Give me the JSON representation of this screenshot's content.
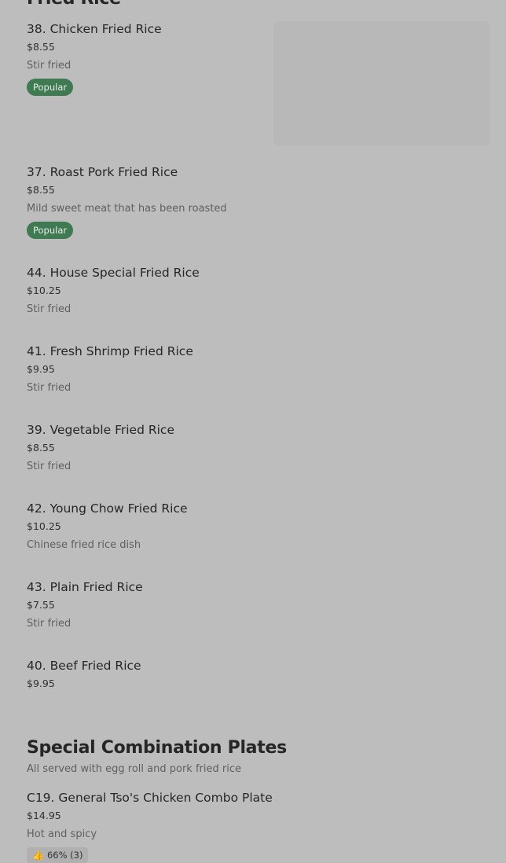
{
  "fried_rice": {
    "title": "Fried Rice",
    "items": [
      {
        "name": "38. Chicken Fried Rice",
        "price": "$8.55",
        "desc": "Stir fried",
        "badge": "Popular"
      },
      {
        "name": "37. Roast Pork Fried Rice",
        "price": "$8.55",
        "desc": "Mild sweet meat that has been roasted",
        "badge": "Popular"
      },
      {
        "name": "44. House Special Fried Rice",
        "price": "$10.25",
        "desc": "Stir fried"
      },
      {
        "name": "41. Fresh Shrimp Fried Rice",
        "price": "$9.95",
        "desc": "Stir fried"
      },
      {
        "name": "39. Vegetable Fried Rice",
        "price": "$8.55",
        "desc": "Stir fried"
      },
      {
        "name": "42. Young Chow Fried Rice",
        "price": "$10.25",
        "desc": "Chinese fried rice dish"
      },
      {
        "name": "43. Plain Fried Rice",
        "price": "$7.55",
        "desc": "Stir fried"
      },
      {
        "name": "40. Beef Fried Rice",
        "price": "$9.95"
      }
    ]
  },
  "combo": {
    "title": "Special Combination Plates",
    "desc": "All served with egg roll and pork fried rice",
    "items": [
      {
        "name": "C19. General Tso's Chicken Combo Plate",
        "price": "$14.95",
        "desc": "Hot and spicy",
        "rating": "66% (3)",
        "rating_icon": "thumbs-up-icon"
      }
    ]
  }
}
